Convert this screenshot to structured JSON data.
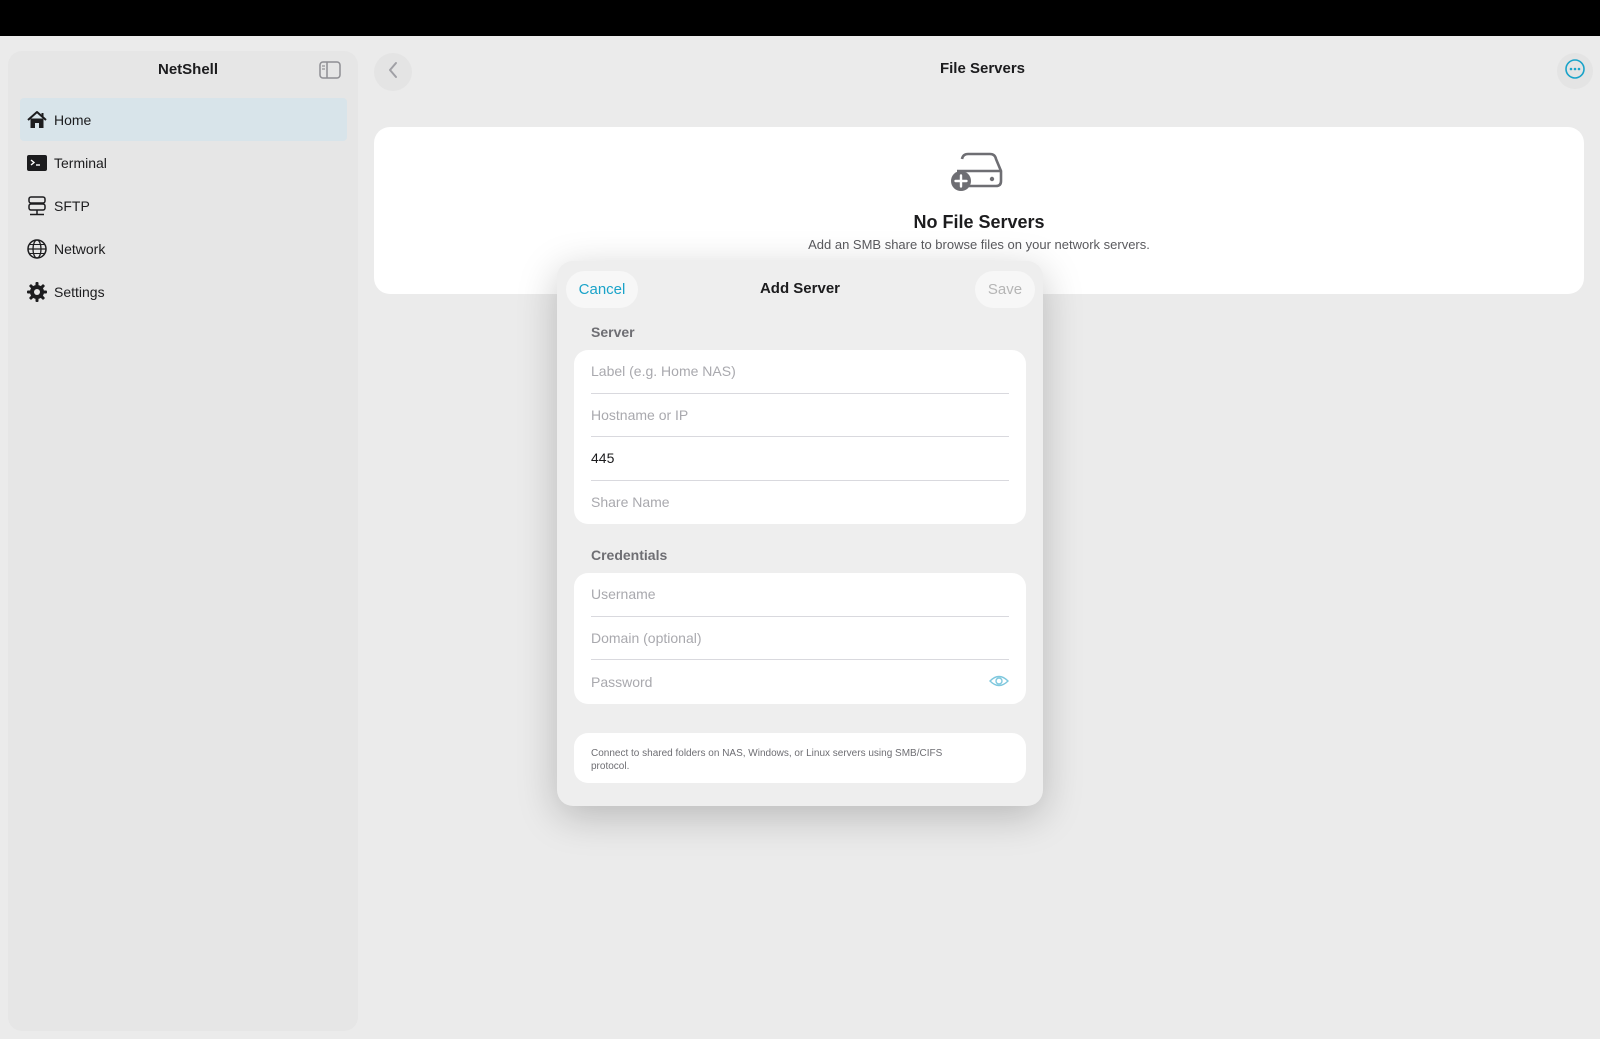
{
  "app": {
    "title": "NetShell"
  },
  "sidebar": {
    "items": [
      {
        "label": "Home",
        "icon": "house-icon",
        "active": true
      },
      {
        "label": "Terminal",
        "icon": "terminal-icon",
        "active": false
      },
      {
        "label": "SFTP",
        "icon": "server-stack-icon",
        "active": false
      },
      {
        "label": "Network",
        "icon": "globe-icon",
        "active": false
      },
      {
        "label": "Settings",
        "icon": "gear-icon",
        "active": false
      }
    ]
  },
  "header": {
    "title": "File Servers"
  },
  "empty_state": {
    "icon": "drive-add-icon",
    "title": "No File Servers",
    "subtitle": "Add an SMB share to browse files on your network servers."
  },
  "modal": {
    "title": "Add Server",
    "cancel_label": "Cancel",
    "save_label": "Save",
    "server_section": {
      "label": "Server",
      "fields": [
        {
          "placeholder": "Label (e.g. Home NAS)",
          "value": ""
        },
        {
          "placeholder": "Hostname or IP",
          "value": ""
        },
        {
          "placeholder": "Port",
          "value": "445"
        },
        {
          "placeholder": "Share Name",
          "value": ""
        }
      ]
    },
    "credentials_section": {
      "label": "Credentials",
      "fields": [
        {
          "placeholder": "Username",
          "value": ""
        },
        {
          "placeholder": "Domain (optional)",
          "value": ""
        },
        {
          "placeholder": "Password",
          "value": ""
        }
      ]
    },
    "info_text": "Connect to shared folders on NAS, Windows, or Linux servers using SMB/CIFS protocol."
  },
  "colors": {
    "accent": "#1aa3c9",
    "active_row": "#d8e4ea",
    "background": "#ebebeb"
  }
}
